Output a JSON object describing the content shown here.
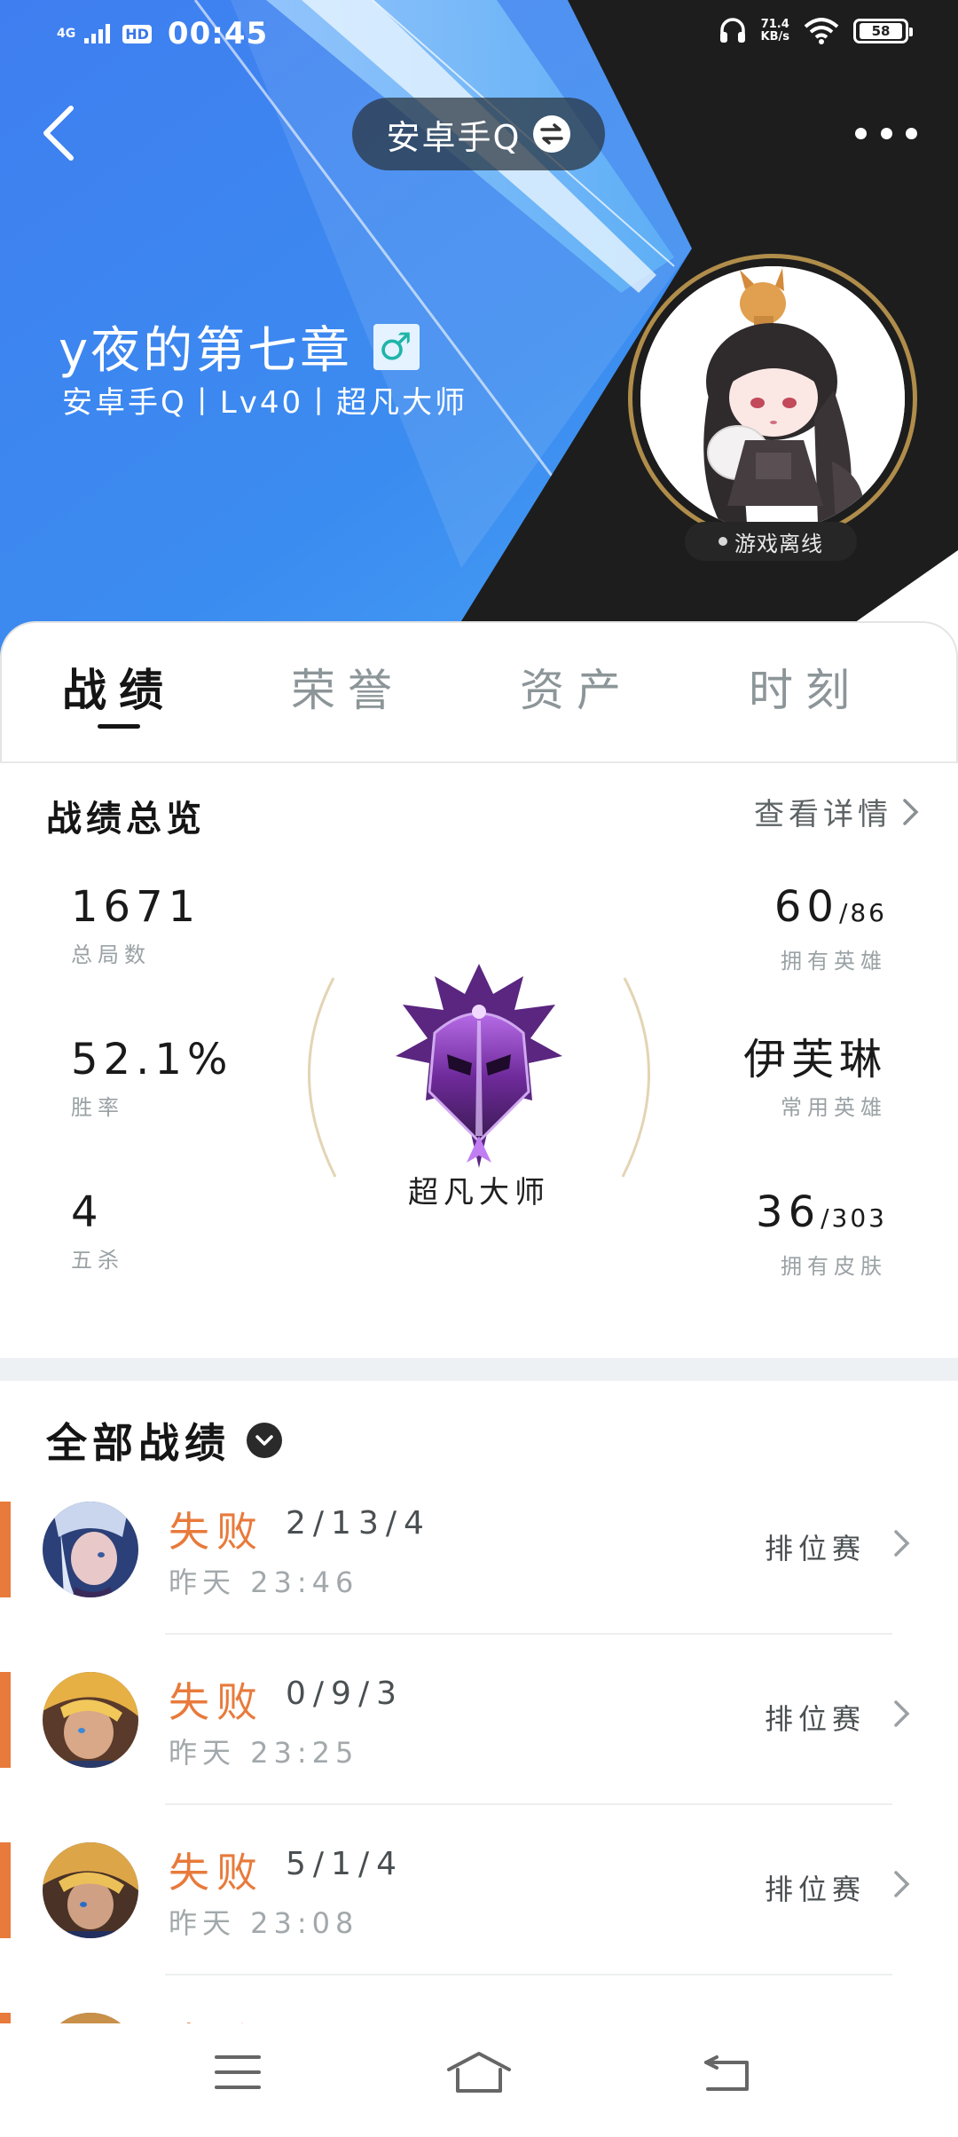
{
  "status_bar": {
    "network": "4G",
    "hd": "HD",
    "time": "00:45",
    "net_speed_value": "71.4",
    "net_speed_unit": "KB/s",
    "battery": "58"
  },
  "header": {
    "server_label": "安卓手Q",
    "player_name": "y夜的第七章",
    "gender_symbol": "♂",
    "player_sub": "安卓手Q丨Lv40丨超凡大师",
    "online_status": "游戏离线"
  },
  "tabs": [
    {
      "label": "战绩",
      "active": true
    },
    {
      "label": "荣誉",
      "active": false
    },
    {
      "label": "资产",
      "active": false
    },
    {
      "label": "时刻",
      "active": false
    }
  ],
  "overview": {
    "title": "战绩总览",
    "detail_link": "查看详情",
    "total_games": {
      "value": "1671",
      "label": "总局数"
    },
    "win_rate": {
      "value": "52.1%",
      "label": "胜率"
    },
    "pentakills": {
      "value": "4",
      "label": "五杀"
    },
    "owned_heroes": {
      "value": "60",
      "total": "/86",
      "label": "拥有英雄"
    },
    "common_hero": {
      "value": "伊芙琳",
      "label": "常用英雄"
    },
    "owned_skins": {
      "value": "36",
      "total": "/303",
      "label": "拥有皮肤"
    },
    "rank": "超凡大师"
  },
  "matches": {
    "title": "全部战绩",
    "items": [
      {
        "result": "失败",
        "kda": "2/13/4",
        "time": "昨天 23:46",
        "mode": "排位赛"
      },
      {
        "result": "失败",
        "kda": "0/9/3",
        "time": "昨天 23:25",
        "mode": "排位赛"
      },
      {
        "result": "失败",
        "kda": "5/1/4",
        "time": "昨天 23:08",
        "mode": "排位赛"
      },
      {
        "result": "失败",
        "kda": "",
        "time": "",
        "mode": ""
      }
    ]
  },
  "colors": {
    "accent_orange": "#e87a3b",
    "header_blue": "#3a7bea",
    "header_dark": "#1d1d1d"
  },
  "icons": [
    "back-arrow-icon",
    "swap-icon",
    "more-icon",
    "male-icon",
    "chevron-right-icon",
    "dropdown-icon",
    "menu-icon",
    "home-icon",
    "return-icon"
  ]
}
